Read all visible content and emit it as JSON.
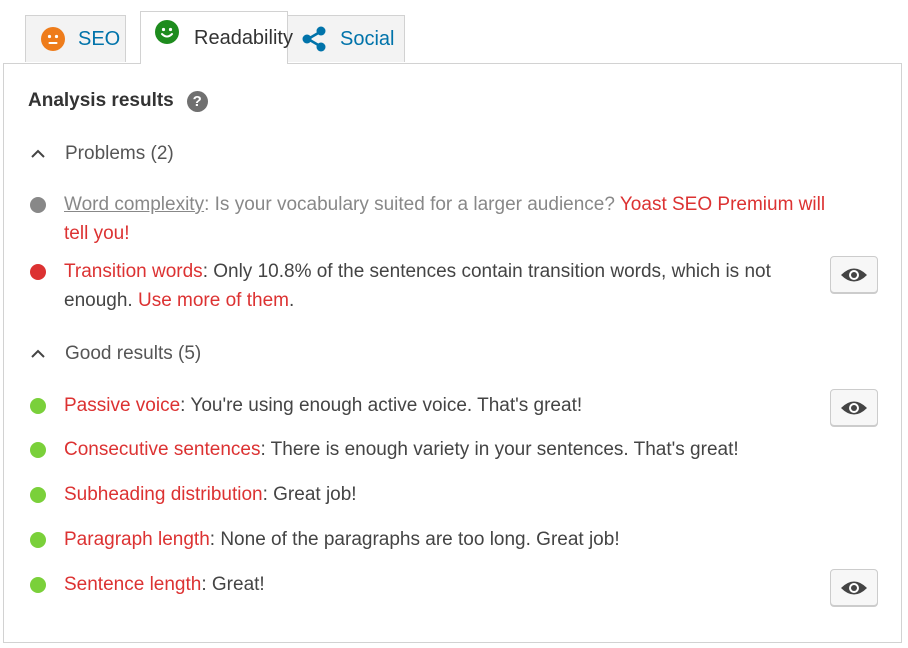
{
  "tabs": [
    {
      "label": "SEO",
      "icon": "neutral-face-icon",
      "color": "#ee7c1b"
    },
    {
      "label": "Readability",
      "icon": "smiley-face-icon",
      "color": "#1e8c1e",
      "active": true
    },
    {
      "label": "Social",
      "icon": "share-icon",
      "color": "#0073aa"
    }
  ],
  "panel": {
    "heading": "Analysis results",
    "help_icon_glyph": "?",
    "problems": {
      "label": "Problems (2)",
      "items": [
        {
          "name": "Word complexity",
          "text": ": Is your vocabulary suited for a larger audience? ",
          "link": "Yoast SEO Premium will tell you!",
          "bullet_color": "#888888"
        },
        {
          "name": "Transition words",
          "text": ": Only 10.8% of the sentences contain transition words, which is not enough. ",
          "link": "Use more of them",
          "suffix": ".",
          "bullet_color": "#dc3232"
        }
      ]
    },
    "good": {
      "label": "Good results (5)",
      "items": [
        {
          "name": "Passive voice",
          "text": ": You're using enough active voice. That's great!",
          "bullet_color": "#7ad03a"
        },
        {
          "name": "Consecutive sentences",
          "text": ": There is enough variety in your sentences. That's great!",
          "bullet_color": "#7ad03a"
        },
        {
          "name": "Subheading distribution",
          "text": ": Great job!",
          "bullet_color": "#7ad03a"
        },
        {
          "name": "Paragraph length",
          "text": ": None of the paragraphs are too long. Great job!",
          "bullet_color": "#7ad03a"
        },
        {
          "name": "Sentence length",
          "text": ": Great!",
          "bullet_color": "#7ad03a"
        }
      ]
    }
  }
}
